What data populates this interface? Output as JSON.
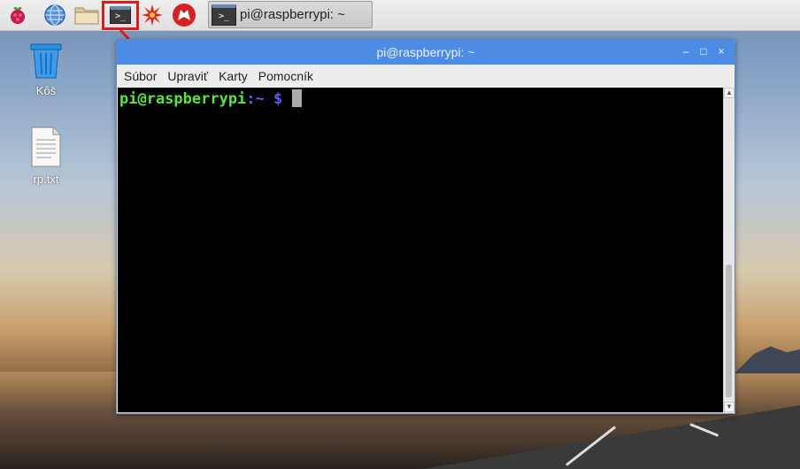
{
  "taskbar": {
    "icons": [
      "raspberry-menu-icon",
      "globe-icon",
      "folder-icon",
      "terminal-icon",
      "burst-icon",
      "wolfram-icon"
    ],
    "task_title": "pi@raspberrypi: ~",
    "terminal_glyph": ">_"
  },
  "desktop": {
    "trash_label": "Kôš",
    "file_label": "rp.txt"
  },
  "window": {
    "title": "pi@raspberrypi: ~",
    "controls": [
      "–",
      "□",
      "×"
    ],
    "menu": [
      "Súbor",
      "Upraviť",
      "Karty",
      "Pomocník"
    ],
    "prompt_user": "pi@raspberrypi",
    "prompt_path": ":~",
    "prompt_symbol": "$"
  },
  "colors": {
    "titlebar": "#4d8ce5",
    "prompt_user": "#5ce33c",
    "prompt_path": "#5a5cff",
    "highlight": "#e01b1b"
  }
}
